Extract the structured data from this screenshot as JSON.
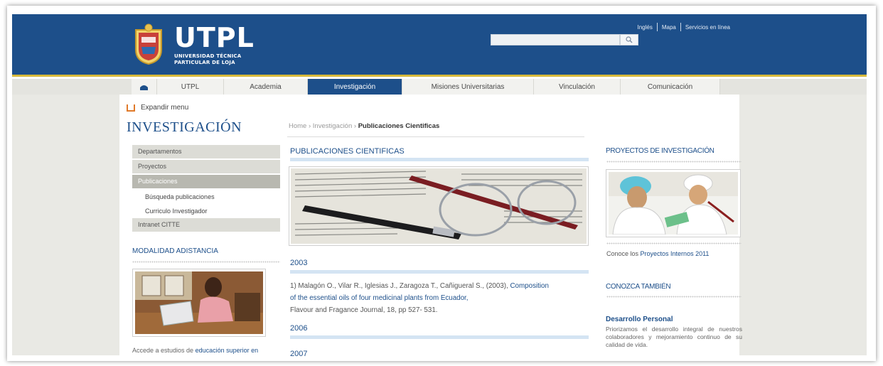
{
  "header": {
    "logo_title": "UTPL",
    "logo_sub_1": "UNIVERSIDAD TÉCNICA",
    "logo_sub_2": "PARTICULAR DE LOJA",
    "top_links": [
      "Inglés",
      "Mapa",
      "Servicios en línea"
    ],
    "search_placeholder": "",
    "colors": {
      "brand_blue": "#1d4f8a",
      "gold_rule": "#d7b93a"
    }
  },
  "nav": {
    "home_icon": "home-icon",
    "items": [
      "UTPL",
      "Academia",
      "Investigación",
      "Misiones Universitarias",
      "Vinculación",
      "Comunicación"
    ],
    "active": "Investigación"
  },
  "page": {
    "expand_label": "Expandir menu",
    "title": "INVESTIGACIÓN",
    "breadcrumb": {
      "home": "Home",
      "sep": "›",
      "section": "Investigación",
      "current": "Publicaciones Cientificas"
    }
  },
  "left_menu": {
    "items": [
      "Departamentos",
      "Proyectos",
      "Publicaciones"
    ],
    "subitems": [
      "Búsqueda publicaciones",
      "Curriculo Investigador"
    ],
    "extra": "Intranet CITTE",
    "modality_title": "MODALIDAD ADISTANCIA",
    "modality_text_1": "Accede a estudios de ",
    "modality_link": "educación superior en"
  },
  "main": {
    "section_title": "PUBLICACIONES CIENTIFICAS",
    "years": [
      "2003",
      "2006",
      "2007"
    ],
    "publication": {
      "authors": "1) Malagón O., Vilar R., Iglesias J., Zaragoza T., Cañigueral S., (2003), ",
      "link_1": "Composition",
      "link_2": "of the essential oils of four medicinal plants from Ecuador,",
      "journal": "Flavour and Fragance Journal, 18, pp 527- 531."
    }
  },
  "right": {
    "projects_title": "PROYECTOS DE INVESTIGACIÓN",
    "projects_text": "Conoce los ",
    "projects_link": "Proyectos Internos 2011",
    "know_title": "CONOZCA TAMBIÉN",
    "dev_title": "Desarrollo Personal",
    "dev_text": "Priorizamos el desarrollo integral de nuestros colaboradores y mejoramiento continuo de su calidad de vida."
  }
}
